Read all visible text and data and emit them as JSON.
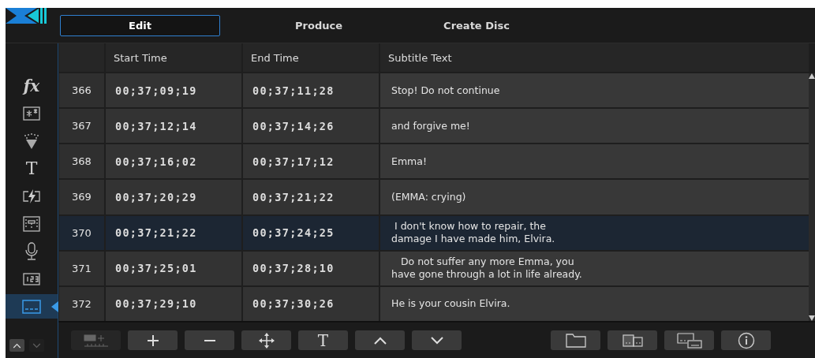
{
  "tabs": [
    {
      "label": "Edit",
      "selected": true
    },
    {
      "label": "Produce",
      "selected": false
    },
    {
      "label": "Create Disc",
      "selected": false
    }
  ],
  "sidebar": {
    "items": [
      {
        "kind": "glyph",
        "glyph": "fx",
        "selected": false
      },
      {
        "kind": "sparkle",
        "selected": false
      },
      {
        "kind": "particles",
        "selected": false
      },
      {
        "kind": "glyph",
        "glyph": "T",
        "selected": false
      },
      {
        "kind": "transition",
        "selected": false
      },
      {
        "kind": "layout",
        "selected": false
      },
      {
        "kind": "microphone",
        "selected": false
      },
      {
        "kind": "counter",
        "selected": false
      },
      {
        "kind": "subtitle",
        "selected": true
      }
    ],
    "scroll_buttons": [
      {
        "kind": "up",
        "disabled": false
      },
      {
        "kind": "down",
        "disabled": true
      }
    ]
  },
  "table": {
    "columns": [
      "Start Time",
      "End Time",
      "Subtitle Text"
    ],
    "rows": [
      {
        "number": "366",
        "start": "00;37;09;19",
        "end": "00;37;11;28",
        "text": [
          "Stop! Do not continue"
        ],
        "selected": false
      },
      {
        "number": "367",
        "start": "00;37;12;14",
        "end": "00;37;14;26",
        "text": [
          "and forgive me!"
        ],
        "selected": false
      },
      {
        "number": "368",
        "start": "00;37;16;02",
        "end": "00;37;17;12",
        "text": [
          "Emma!"
        ],
        "selected": false
      },
      {
        "number": "369",
        "start": "00;37;20;29",
        "end": "00;37;21;22",
        "text": [
          "(EMMA: crying)"
        ],
        "selected": false
      },
      {
        "number": "370",
        "start": "00;37;21;22",
        "end": "00;37;24;25",
        "text": [
          " I don't know how to repair, the",
          "damage I have made him, Elvira."
        ],
        "selected": true
      },
      {
        "number": "371",
        "start": "00;37;25;01",
        "end": "00;37;28;10",
        "text": [
          "   Do not suffer any more Emma, you",
          "have gone through a lot in life already."
        ],
        "selected": false
      },
      {
        "number": "372",
        "start": "00;37;29;10",
        "end": "00;37;30;26",
        "text": [
          "He is your cousin Elvira."
        ],
        "selected": false
      }
    ]
  },
  "toolbar": {
    "left": [
      {
        "kind": "insert",
        "disabled": true
      },
      {
        "kind": "plus",
        "disabled": false
      },
      {
        "kind": "minus",
        "disabled": false
      },
      {
        "kind": "move",
        "disabled": false
      },
      {
        "kind": "glyph",
        "glyph": "T",
        "disabled": false
      },
      {
        "kind": "up",
        "disabled": false
      },
      {
        "kind": "down",
        "disabled": false
      }
    ],
    "right": [
      {
        "kind": "folder",
        "disabled": false
      },
      {
        "kind": "split",
        "disabled": false
      },
      {
        "kind": "merge",
        "disabled": false
      },
      {
        "kind": "info",
        "disabled": false
      }
    ]
  }
}
